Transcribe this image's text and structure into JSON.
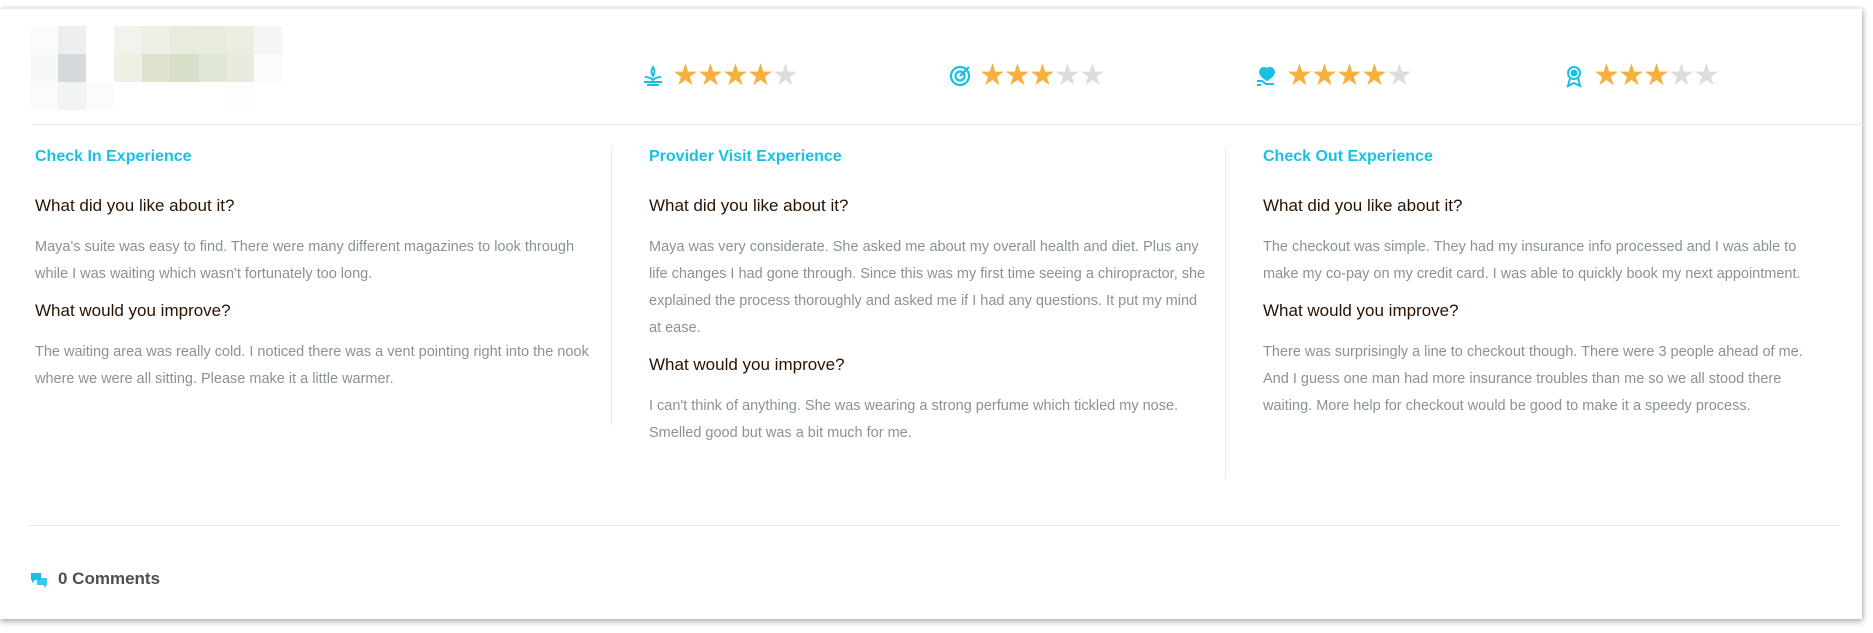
{
  "ratings": [
    {
      "icon": "spa-icon",
      "value": 4,
      "max": 5
    },
    {
      "icon": "target-icon",
      "value": 3,
      "max": 5
    },
    {
      "icon": "heart-hand-icon",
      "value": 4,
      "max": 5
    },
    {
      "icon": "award-ribbon-icon",
      "value": 3,
      "max": 5
    }
  ],
  "sections": [
    {
      "title": "Check In Experience",
      "like_q": "What did you like about it?",
      "like_a": "Maya's suite was easy to find. There were many different magazines to look through while I was waiting which wasn't fortunately too long.",
      "improve_q": "What would you improve?",
      "improve_a": "The waiting area was really cold. I noticed there was a vent pointing right into the nook where we were all sitting. Please make it a little warmer."
    },
    {
      "title": "Provider Visit Experience",
      "like_q": "What did you like about it?",
      "like_a": "Maya was very considerate. She asked me about my overall health and diet. Plus any life changes I had gone through. Since this was my first time seeing a chiropractor, she explained the process thoroughly and asked me if I had any questions. It put my mind at ease.",
      "improve_q": "What would you improve?",
      "improve_a": "I can't think of anything. She was wearing a strong perfume which tickled my nose. Smelled good but was a bit much for me."
    },
    {
      "title": "Check Out Experience",
      "like_q": "What did you like about it?",
      "like_a": "The checkout was simple. They had my insurance info processed and I was able to make my co-pay on my credit card. I was able to quickly book my next appointment.",
      "improve_q": "What would you improve?",
      "improve_a": "There was surprisingly a line to checkout though. There were 3 people ahead of me. And I guess one man had more insurance troubles than me so we all stood there waiting. More help for checkout would be good to make it a speedy process."
    }
  ],
  "comments": {
    "label": "0 Comments"
  },
  "colors": {
    "accent": "#19c0e6",
    "star": "#f5b13d",
    "star_off": "#dddddd"
  }
}
